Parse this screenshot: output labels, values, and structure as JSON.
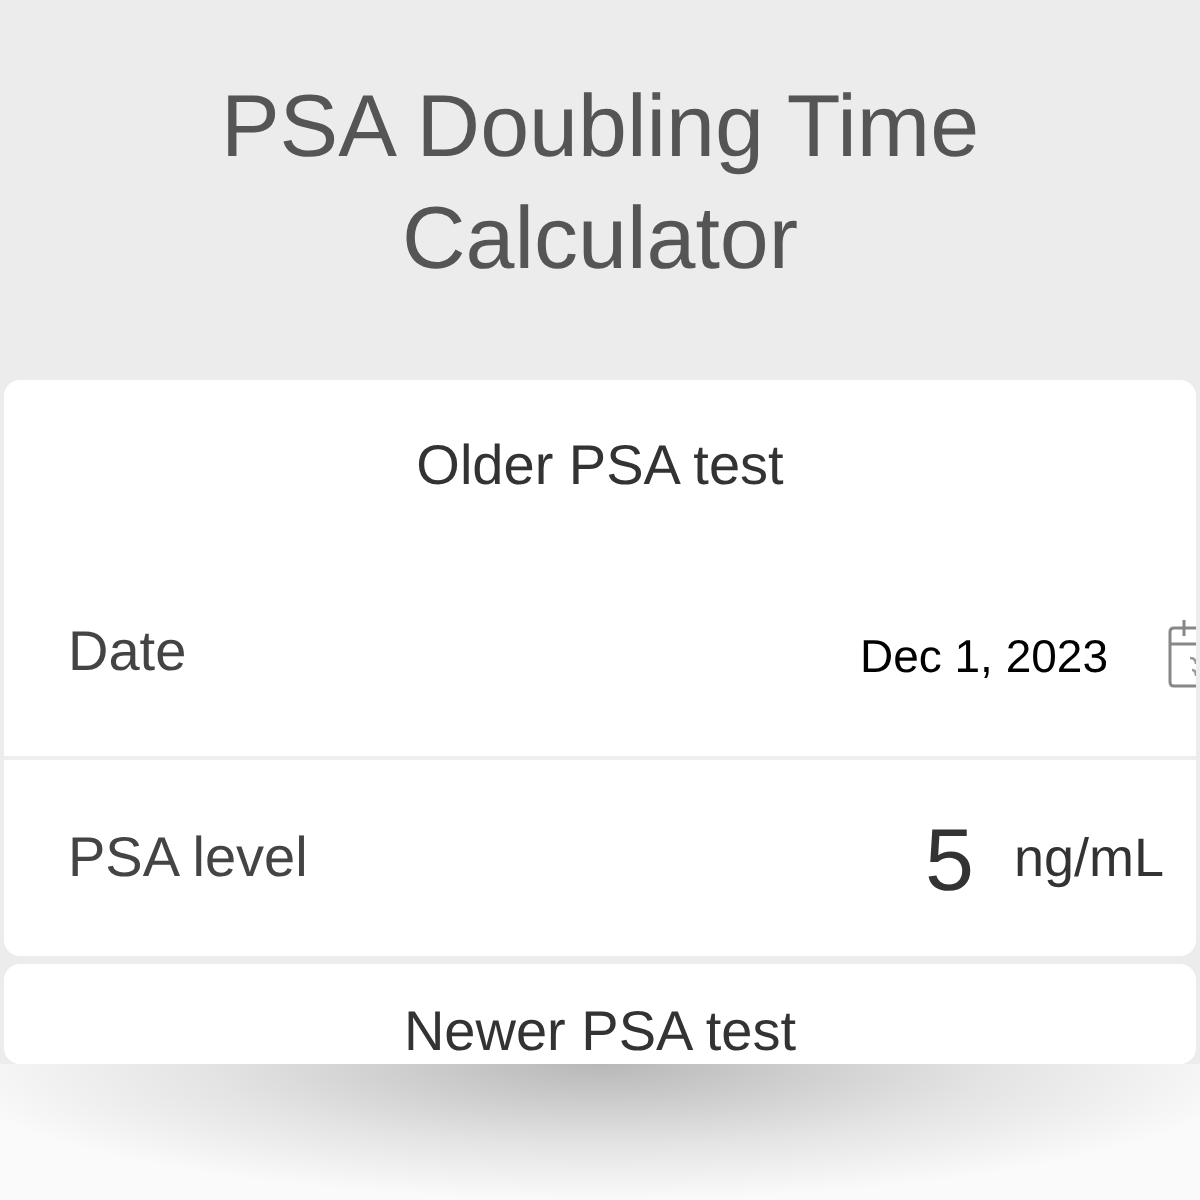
{
  "title": "PSA Doubling Time Calculator",
  "sections": [
    {
      "heading": "Older PSA test",
      "fields": [
        {
          "kind": "date",
          "label": "Date",
          "value": "Dec 1, 2023"
        },
        {
          "kind": "number",
          "label": "PSA level",
          "value": "5",
          "unit": "ng/mL"
        }
      ]
    },
    {
      "heading": "Newer PSA test"
    }
  ]
}
